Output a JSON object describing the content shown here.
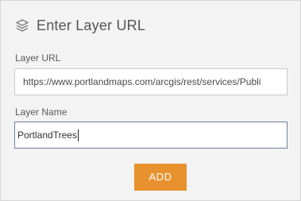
{
  "header": {
    "title": "Enter Layer URL",
    "icon": "layers-icon"
  },
  "form": {
    "url_label": "Layer URL",
    "url_value": "https://www.portlandmaps.com/arcgis/rest/services/Publi",
    "name_label": "Layer Name",
    "name_value": "PortlandTrees"
  },
  "actions": {
    "add_label": "ADD"
  },
  "colors": {
    "accent": "#e8922f",
    "panel_background": "#f3f3f3",
    "focused_border": "#6d7f99"
  }
}
